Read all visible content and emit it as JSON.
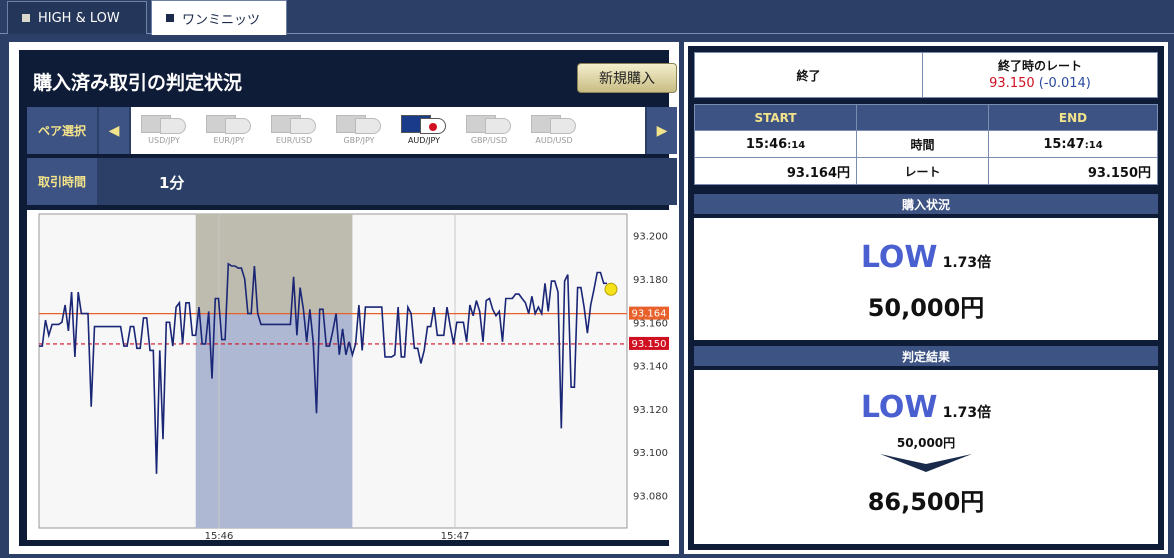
{
  "tabs": [
    {
      "label": "HIGH & LOW"
    },
    {
      "label": "ワンミニッツ"
    }
  ],
  "left": {
    "title": "購入済み取引の判定状況",
    "new_purchase": "新規購入",
    "pair_label": "ペア選択",
    "pairs": [
      "USD/JPY",
      "EUR/JPY",
      "EUR/USD",
      "GBP/JPY",
      "AUD/JPY",
      "GBP/USD",
      "AUD/USD"
    ],
    "active_pair": "AUD/JPY",
    "time_label": "取引時間",
    "time_value": "1分"
  },
  "chart_data": {
    "type": "line",
    "x_ticks": [
      "15:46",
      "15:47"
    ],
    "y_ticks": [
      "93.200",
      "93.180",
      "93.160",
      "93.140",
      "93.120",
      "93.100",
      "93.080"
    ],
    "ylim": [
      93.065,
      93.21
    ],
    "entry_rate": "93.164",
    "end_rate": "93.150",
    "values": [
      93.149,
      93.149,
      93.161,
      93.154,
      93.159,
      93.159,
      93.159,
      93.16,
      93.168,
      93.156,
      93.174,
      93.144,
      93.174,
      93.164,
      93.164,
      93.164,
      93.121,
      93.158,
      93.158,
      93.158,
      93.158,
      93.158,
      93.158,
      93.158,
      93.158,
      93.158,
      93.149,
      93.149,
      93.158,
      93.158,
      93.148,
      93.148,
      93.162,
      93.162,
      93.147,
      93.147,
      93.09,
      93.147,
      93.106,
      93.16,
      93.16,
      93.149,
      93.167,
      93.169,
      93.15,
      93.169,
      93.169,
      93.154,
      93.154,
      93.167,
      93.15,
      93.15,
      93.165,
      93.134,
      93.171,
      93.171,
      93.152,
      93.152,
      93.187,
      93.186,
      93.186,
      93.185,
      93.185,
      93.18,
      93.164,
      93.164,
      93.186,
      93.164,
      93.159,
      93.159,
      93.159,
      93.159,
      93.159,
      93.159,
      93.159,
      93.159,
      93.159,
      93.159,
      93.181,
      93.154,
      93.176,
      93.166,
      93.151,
      93.166,
      93.151,
      93.118,
      93.166,
      93.166,
      93.149,
      93.149,
      93.156,
      93.164,
      93.145,
      93.157,
      93.145,
      93.151,
      93.145,
      93.15,
      93.168,
      93.147,
      93.167,
      93.167,
      93.167,
      93.167,
      93.167,
      93.167,
      93.144,
      93.144,
      93.144,
      93.145,
      93.167,
      93.144,
      93.144,
      93.167,
      93.164,
      93.148,
      93.148,
      93.141,
      93.147,
      93.158,
      93.158,
      93.167,
      93.154,
      93.154,
      93.154,
      93.167,
      93.158,
      93.15,
      93.16,
      93.16,
      93.16,
      93.151,
      93.168,
      93.163,
      93.17,
      93.165,
      93.151,
      93.17,
      93.171,
      93.166,
      93.163,
      93.165,
      93.151,
      93.171,
      93.171,
      93.171,
      93.173,
      93.173,
      93.171,
      93.169,
      93.164,
      93.172,
      93.164,
      93.167,
      93.164,
      93.178,
      93.165,
      93.179,
      93.179,
      93.174,
      93.111,
      93.179,
      93.182,
      93.13,
      93.13,
      93.176,
      93.176,
      93.167,
      93.155,
      93.168,
      93.175,
      93.183,
      93.183,
      93.178,
      93.178
    ],
    "shaded_from_index": 48,
    "shaded_to_index": 96,
    "shade_divider_index": 144,
    "colors": {
      "line": "#1a2676",
      "entry": "#e8602a",
      "end": "#d01020",
      "shade_upper": "#bdbcae",
      "shade_lower": "#aeb8d3",
      "marker": "#f5e21b"
    }
  },
  "right": {
    "status_label": "終了",
    "rate_label": "終了時のレート",
    "rate_value": "93.150",
    "rate_diff": "(-0.014)",
    "start_label": "START",
    "end_label": "END",
    "start_time": "15:46",
    "start_sec": ":14",
    "time_label": "時間",
    "end_time": "15:47",
    "end_sec": ":14",
    "start_rate": "93.164円",
    "rate_row_label": "レート",
    "end_rate": "93.150円",
    "purchase_header": "購入状況",
    "purchase_dir": "LOW",
    "purchase_mult": "1.73倍",
    "purchase_amount": "50,000円",
    "result_header": "判定結果",
    "result_dir": "LOW",
    "result_mult": "1.73倍",
    "result_stake": "50,000円",
    "payout": "86,500円"
  }
}
